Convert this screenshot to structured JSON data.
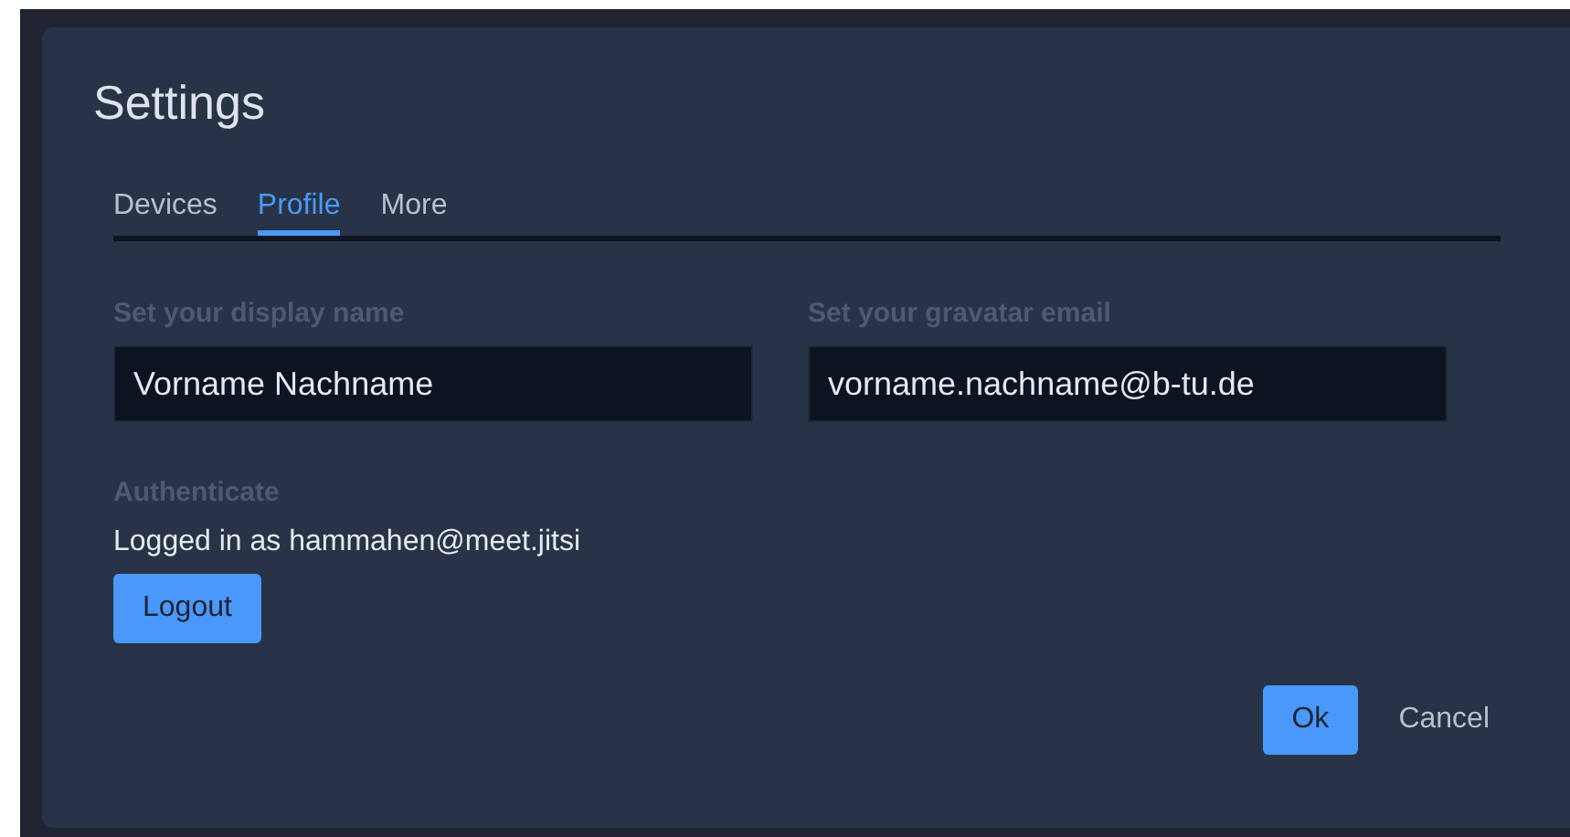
{
  "window": {
    "title": "Settings"
  },
  "tabs": [
    {
      "label": "Devices",
      "selected": false
    },
    {
      "label": "Profile",
      "selected": true
    },
    {
      "label": "More",
      "selected": false
    }
  ],
  "fields": [
    {
      "label": "Set your display name",
      "value": "Vorname Nachname"
    },
    {
      "label": "Set your gravatar email",
      "value": "vorname.nachname@b-tu.de"
    }
  ],
  "authenticate": {
    "heading": "Authenticate",
    "status": "Logged in as hammahen@meet.jitsi",
    "button": "Logout"
  },
  "buttons": [
    {
      "label": "Ok",
      "kind": "primary"
    },
    {
      "label": "Cancel",
      "kind": "plain"
    }
  ]
}
